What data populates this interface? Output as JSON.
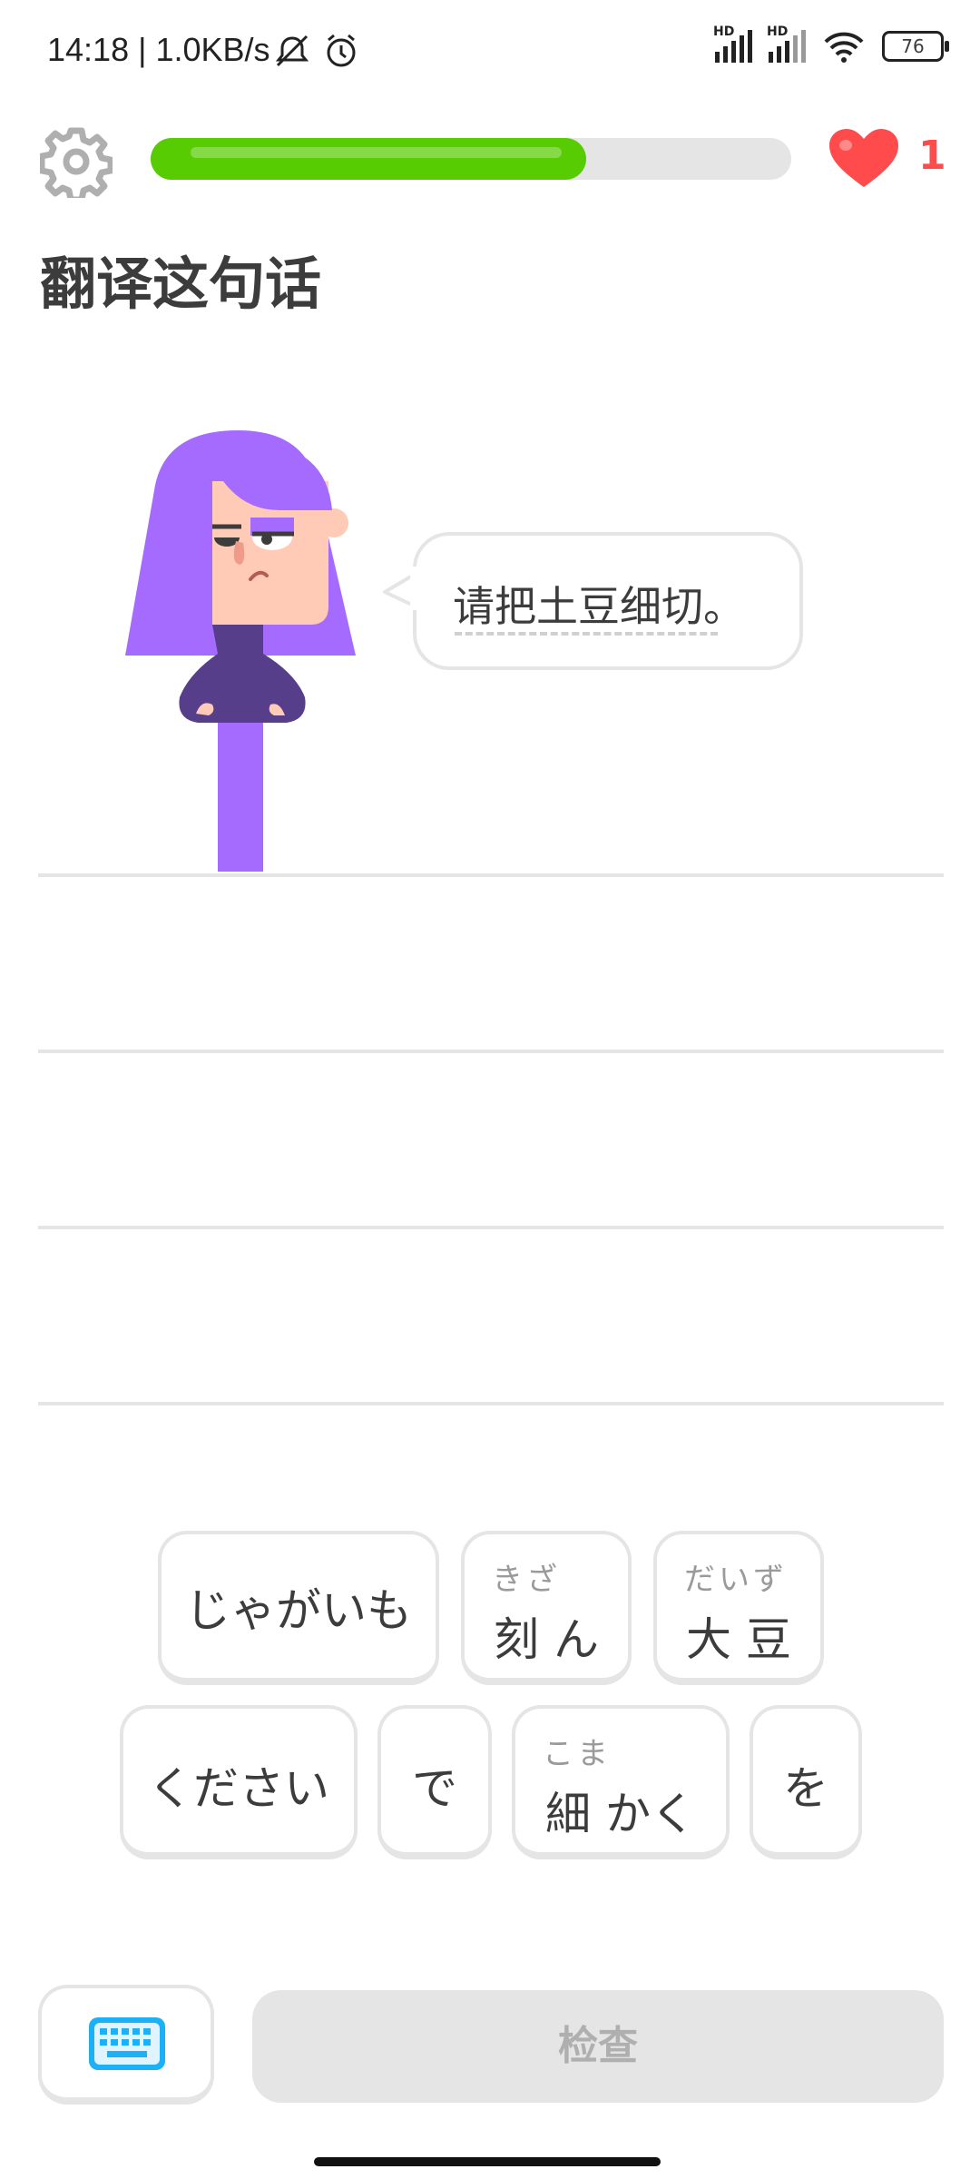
{
  "status_bar": {
    "time_speed": "14:18 | 1.0KB/s",
    "network_badges": [
      "HD",
      "HD"
    ],
    "battery": "76",
    "icons": [
      "mute-icon",
      "alarm-icon",
      "signal-icon",
      "signal-icon",
      "wifi-icon",
      "battery-icon"
    ]
  },
  "header": {
    "progress_fraction": 0.68,
    "hearts": "1",
    "heart_color": "#ff4b4b",
    "progress_color": "#58cc02"
  },
  "prompt": {
    "title": "翻译这句话",
    "sentence": "请把土豆细切。"
  },
  "word_bank": [
    {
      "text": "じゃがいも",
      "ruby": ""
    },
    {
      "text": "刻 ん",
      "ruby": "きざ"
    },
    {
      "text": "大 豆",
      "ruby": "だいず"
    },
    {
      "text": "ください",
      "ruby": ""
    },
    {
      "text": "で",
      "ruby": ""
    },
    {
      "text": "細 かく",
      "ruby": "こま"
    },
    {
      "text": "を",
      "ruby": ""
    }
  ],
  "footer": {
    "keyboard_icon": "keyboard-icon",
    "check_label": "检查"
  }
}
